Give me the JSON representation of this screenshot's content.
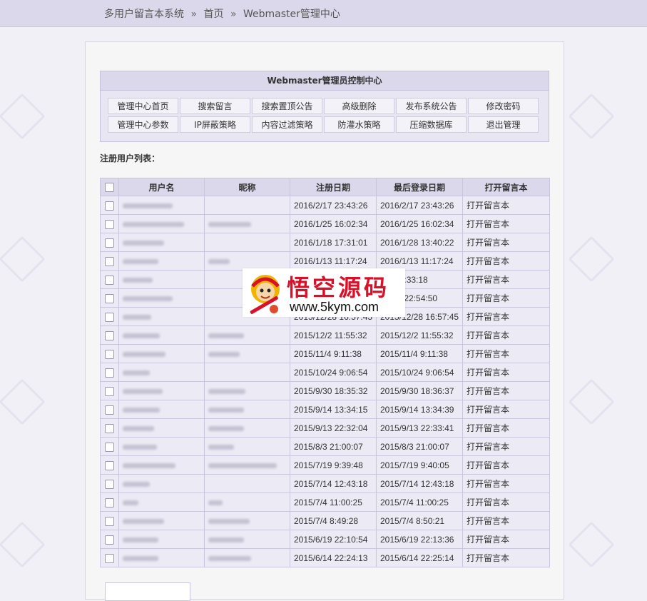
{
  "breadcrumb": {
    "site": "多用户留言本系统",
    "sep1": "»",
    "home": "首页",
    "sep2": "»",
    "current": "Webmaster管理中心"
  },
  "control_panel": {
    "title": "Webmaster管理员控制中心",
    "buttons": [
      "管理中心首页",
      "搜索留言",
      "搜索置顶公告",
      "高级删除",
      "发布系统公告",
      "修改密码",
      "管理中心参数",
      "IP屏蔽策略",
      "内容过滤策略",
      "防灌水策略",
      "压缩数据库",
      "退出管理"
    ]
  },
  "user_list": {
    "label": "注册用户列表：",
    "columns": [
      "用户名",
      "昵称",
      "注册日期",
      "最后登录日期",
      "打开留言本"
    ],
    "rows": [
      {
        "registered": "2016/2/17 23:43:26",
        "last_login": "2016/2/17 23:43:26",
        "action": "打开留言本"
      },
      {
        "registered": "2016/1/25 16:02:34",
        "last_login": "2016/1/25 16:02:34",
        "action": "打开留言本"
      },
      {
        "registered": "2016/1/18 17:31:01",
        "last_login": "2016/1/28 13:40:22",
        "action": "打开留言本"
      },
      {
        "registered": "2016/1/13 11:17:24",
        "last_login": "2016/1/13 11:17:24",
        "action": "打开留言本"
      },
      {
        "registered": "",
        "last_login": "1/7 23:33:18",
        "action": "打开留言本"
      },
      {
        "registered": "",
        "last_login": "12/29 22:54:50",
        "action": "打开留言本"
      },
      {
        "registered": "2015/12/28 16:57:45",
        "last_login": "2015/12/28 16:57:45",
        "action": "打开留言本"
      },
      {
        "registered": "2015/12/2 11:55:32",
        "last_login": "2015/12/2 11:55:32",
        "action": "打开留言本"
      },
      {
        "registered": "2015/11/4 9:11:38",
        "last_login": "2015/11/4 9:11:38",
        "action": "打开留言本"
      },
      {
        "registered": "2015/10/24 9:06:54",
        "last_login": "2015/10/24 9:06:54",
        "action": "打开留言本"
      },
      {
        "registered": "2015/9/30 18:35:32",
        "last_login": "2015/9/30 18:36:37",
        "action": "打开留言本"
      },
      {
        "registered": "2015/9/14 13:34:15",
        "last_login": "2015/9/14 13:34:39",
        "action": "打开留言本"
      },
      {
        "registered": "2015/9/13 22:32:04",
        "last_login": "2015/9/13 22:33:41",
        "action": "打开留言本"
      },
      {
        "registered": "2015/8/3 21:00:07",
        "last_login": "2015/8/3 21:00:07",
        "action": "打开留言本"
      },
      {
        "registered": "2015/7/19 9:39:48",
        "last_login": "2015/7/19 9:40:05",
        "action": "打开留言本"
      },
      {
        "registered": "2015/7/14 12:43:18",
        "last_login": "2015/7/14 12:43:18",
        "action": "打开留言本"
      },
      {
        "registered": "2015/7/4 11:00:25",
        "last_login": "2015/7/4 11:00:25",
        "action": "打开留言本"
      },
      {
        "registered": "2015/7/4 8:49:28",
        "last_login": "2015/7/4 8:50:21",
        "action": "打开留言本"
      },
      {
        "registered": "2015/6/19 22:10:54",
        "last_login": "2015/6/19 22:13:36",
        "action": "打开留言本"
      },
      {
        "registered": "2015/6/14 22:24:13",
        "last_login": "2015/6/14 22:25:14",
        "action": "打开留言本"
      }
    ]
  },
  "watermark": {
    "brand": "悟空源码",
    "url": "www.5kym.com"
  },
  "colors": {
    "header_bg": "#dcd8ec",
    "table_cell_bg": "#eceaf5",
    "page_bg": "#f1f0f7",
    "watermark_red": "#d8112a"
  }
}
